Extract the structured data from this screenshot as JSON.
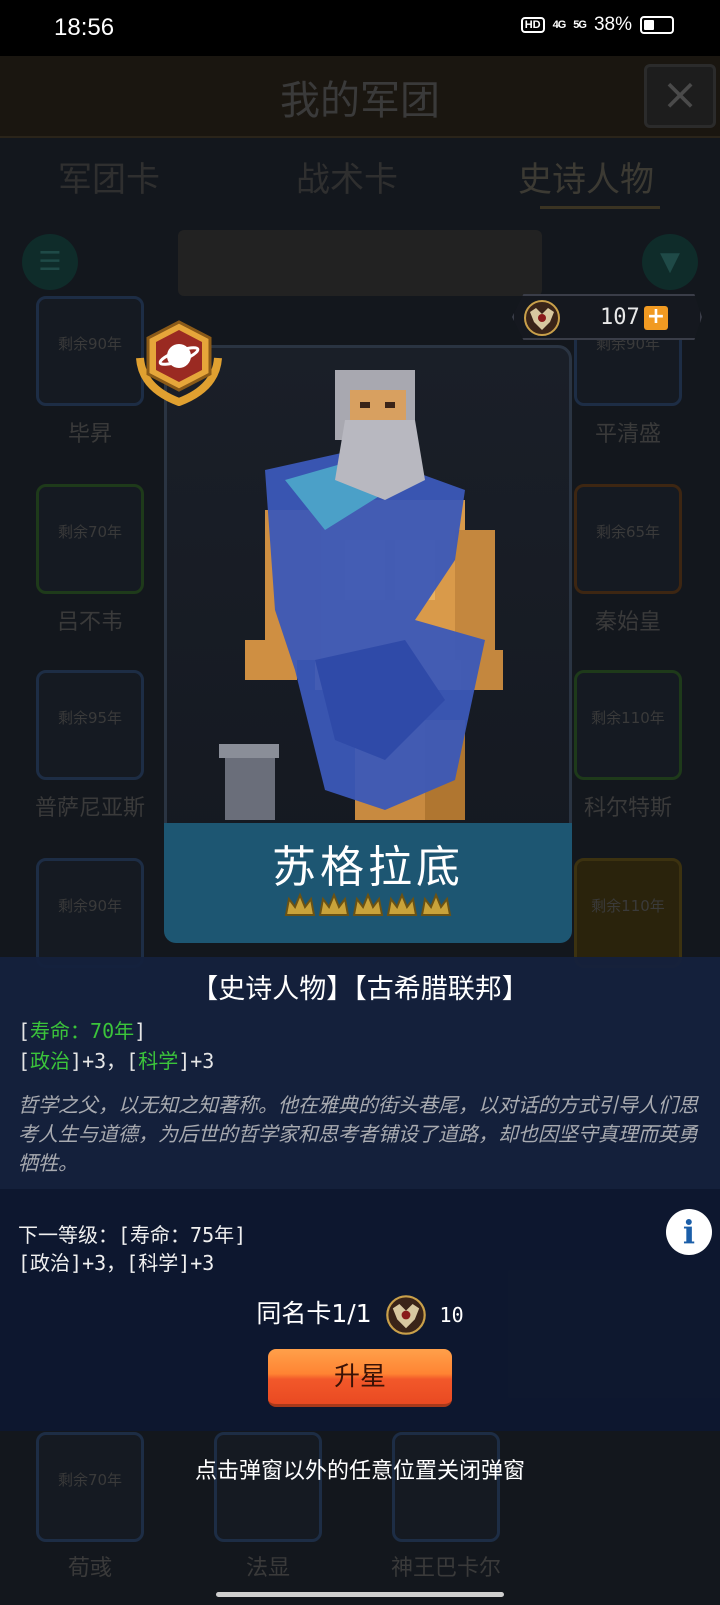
{
  "status_bar": {
    "time": "18:56",
    "network_hd": "HD",
    "network_4g": "4G",
    "network_5g": "5G",
    "battery": "38%"
  },
  "background": {
    "title": "我的军团",
    "close_icon": "×",
    "tabs": [
      "军团卡",
      "战术卡",
      "史诗人物"
    ],
    "cards": [
      {
        "text": "剩余90年",
        "name": "毕昇"
      },
      {
        "text": "剩余90年",
        "name": "平清盛"
      },
      {
        "text": "剩余70年",
        "name": "吕不韦"
      },
      {
        "text": "剩余65年",
        "name": "秦始皇"
      },
      {
        "text": "剩余95年",
        "name": "普萨尼亚斯"
      },
      {
        "text": "剩余110年",
        "name": "科尔特斯"
      },
      {
        "text": "剩余90年",
        "name": ""
      },
      {
        "text": "剩余110年",
        "name": ""
      },
      {
        "text": "剩余70年",
        "name": "荀彧"
      },
      {
        "text": "",
        "name": "法显"
      },
      {
        "text": "",
        "name": "神王巴卡尔"
      }
    ]
  },
  "currency": {
    "value": "107",
    "plus_label": "+",
    "icon": "eagle-emblem-icon"
  },
  "character": {
    "name": "苏格拉底",
    "star_count": 5,
    "badge_icon": "planet-laurel-icon"
  },
  "info": {
    "header": "【史诗人物】【古希腊联邦】",
    "lifespan_open": "[",
    "lifespan_text": "寿命：70年",
    "lifespan_close": "]",
    "attr_open1": "[",
    "attr_name1": "政治",
    "attr_val1": "]+3，",
    "attr_open2": "[",
    "attr_name2": "科学",
    "attr_val2": "]+3",
    "description": "哲学之父，以无知之知著称。他在雅典的街头巷尾，以对话的方式引导人们思考人生与道德，为后世的哲学家和思考者铺设了道路，却也因坚守真理而英勇牺牲。"
  },
  "upgrade": {
    "next_level_line": "下一等级：[寿命：75年]",
    "next_attr_line": "[政治]+3，[科学]+3",
    "info_icon": "i",
    "dup_label": "同名卡1/1",
    "dup_cost": "10",
    "button_label": "升星"
  },
  "hint": "点击弹窗以外的任意位置关闭弹窗"
}
